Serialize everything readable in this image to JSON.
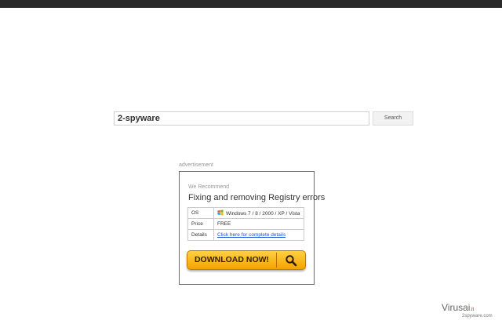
{
  "search": {
    "value": "2-spyware",
    "button_label": "Search"
  },
  "advertisement": {
    "label": "advertisement",
    "recommend": "We Recommend",
    "title": "Fixing and removing Registry errors",
    "rows": [
      {
        "key": "OS",
        "value": "Windows 7 / 8 / 2000 / XP / Vista",
        "icon": "windows-logo-icon"
      },
      {
        "key": "Price",
        "value": "FREE"
      },
      {
        "key": "Details",
        "value": "Click here for complete details"
      }
    ],
    "download_label": "DOWNLOAD NOW!",
    "button_colors": {
      "top": "#ffd042",
      "bottom": "#f5a300"
    }
  },
  "watermark": {
    "name": "Virusai",
    "tld": ".lt",
    "sub": "2spyware.com"
  },
  "colors": {
    "topbar": "#2a2a2a",
    "link": "#1a4fd1"
  }
}
